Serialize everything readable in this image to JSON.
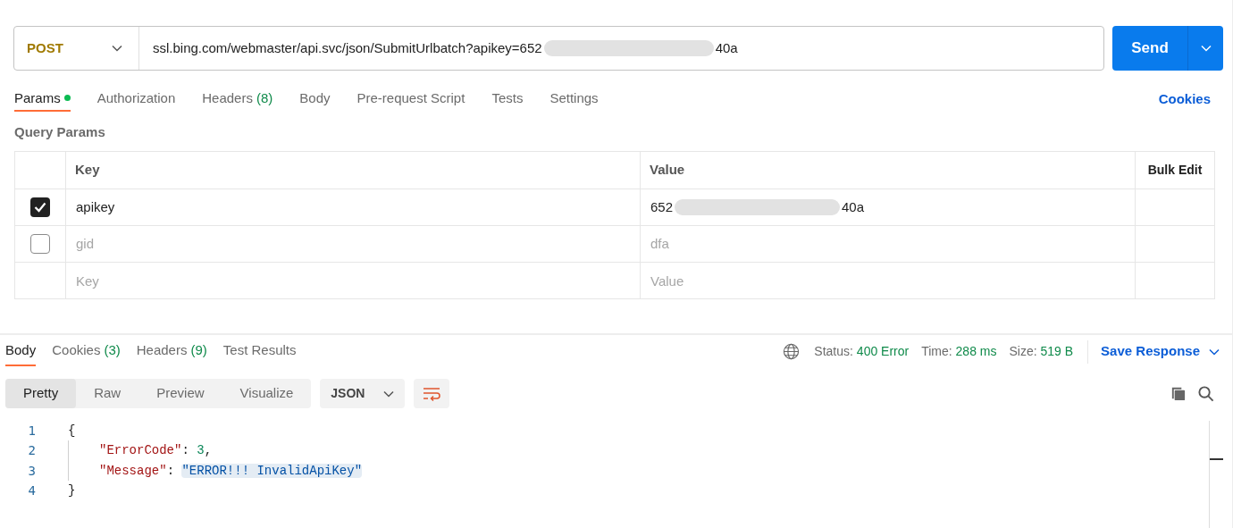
{
  "request": {
    "method": "POST",
    "url_start": "ssl.bing.com/webmaster/api.svc/json/SubmitUrlbatch?apikey=652",
    "url_end": "40a",
    "send_label": "Send"
  },
  "request_tabs": [
    {
      "label": "Params",
      "dot": true,
      "selected": true
    },
    {
      "label": "Authorization",
      "dot": false,
      "selected": false
    },
    {
      "label": "Headers",
      "count": "(8)",
      "dot": false,
      "selected": false
    },
    {
      "label": "Body",
      "dot": false,
      "selected": false
    },
    {
      "label": "Pre-request Script",
      "dot": false,
      "selected": false
    },
    {
      "label": "Tests",
      "dot": false,
      "selected": false
    },
    {
      "label": "Settings",
      "dot": false,
      "selected": false
    }
  ],
  "cookies_link": "Cookies",
  "query_params": {
    "title": "Query Params",
    "columns": [
      "Key",
      "Value"
    ],
    "bulk_edit": "Bulk Edit",
    "rows": [
      {
        "checked": true,
        "key": "apikey",
        "value": "652",
        "value_end": "40a"
      },
      {
        "checked": false,
        "key": "gid",
        "value": "dfa"
      }
    ],
    "new_row": {
      "key_placeholder": "Key",
      "value_placeholder": "Value"
    }
  },
  "response": {
    "tabs": [
      {
        "label": "Body",
        "selected": true
      },
      {
        "label": "Cookies",
        "count": "(3)",
        "selected": false
      },
      {
        "label": "Headers",
        "count": "(9)",
        "selected": false
      },
      {
        "label": "Test Results",
        "selected": false
      }
    ],
    "stats": [
      {
        "label": "Status:",
        "value": "400 Error"
      },
      {
        "label": "Time:",
        "value": "288 ms"
      },
      {
        "label": "Size:",
        "value": "519 B"
      }
    ],
    "save_response": "Save Response",
    "view_modes": [
      {
        "label": "Pretty",
        "selected": true
      },
      {
        "label": "Raw",
        "selected": false
      },
      {
        "label": "Preview",
        "selected": false
      },
      {
        "label": "Visualize",
        "selected": false
      }
    ],
    "format": "JSON",
    "code_lines": [
      {
        "number": "1",
        "tokens": [
          {
            "kind": "punct",
            "text": "{"
          }
        ]
      },
      {
        "number": "2",
        "tokens": [
          {
            "kind": "key",
            "text": "\"ErrorCode\""
          },
          {
            "kind": "punct",
            "text": ": "
          },
          {
            "kind": "number",
            "text": "3"
          },
          {
            "kind": "punct",
            "text": ","
          }
        ]
      },
      {
        "number": "3",
        "tokens": [
          {
            "kind": "key",
            "text": "\"Message\""
          },
          {
            "kind": "punct",
            "text": ": "
          },
          {
            "kind": "string",
            "text": "\"ERROR!!! InvalidApiKey\"",
            "highlighted": true
          }
        ]
      },
      {
        "number": "4",
        "tokens": [
          {
            "kind": "punct",
            "text": "}"
          }
        ]
      }
    ]
  }
}
